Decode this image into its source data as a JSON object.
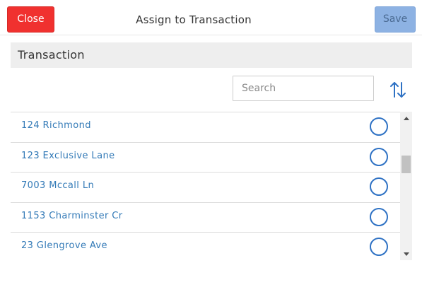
{
  "header": {
    "close_label": "Close",
    "title": "Assign to Transaction",
    "save_label": "Save"
  },
  "section": {
    "label": "Transaction"
  },
  "search": {
    "placeholder": "Search",
    "value": ""
  },
  "list": {
    "items": [
      {
        "label": "124 Richmond",
        "selected": false
      },
      {
        "label": "123 Exclusive Lane",
        "selected": false
      },
      {
        "label": "7003 Mccall Ln",
        "selected": false
      },
      {
        "label": "1153 Charminster Cr",
        "selected": false
      },
      {
        "label": "23 Glengrove Ave",
        "selected": false
      }
    ]
  },
  "icons": {
    "sort": "sort-arrows-icon",
    "scroll_up": "scroll-up-arrow-icon",
    "scroll_down": "scroll-down-arrow-icon"
  },
  "colors": {
    "close_button": "#f0312f",
    "save_button": "#8db2e3",
    "link_text": "#337ab7",
    "radio_border": "#2f72c4",
    "section_bg": "#eeeeee"
  }
}
